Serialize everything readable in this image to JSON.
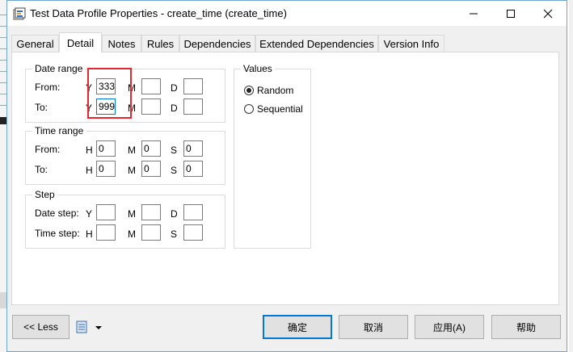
{
  "window": {
    "title": "Test Data Profile Properties - create_time (create_time)"
  },
  "tabs": [
    {
      "label": "General",
      "active": false
    },
    {
      "label": "Detail",
      "active": true
    },
    {
      "label": "Notes",
      "active": false
    },
    {
      "label": "Rules",
      "active": false
    },
    {
      "label": "Dependencies",
      "active": false
    },
    {
      "label": "Extended Dependencies",
      "active": false
    },
    {
      "label": "Version Info",
      "active": false
    }
  ],
  "date_range": {
    "title": "Date range",
    "from_label": "From:",
    "to_label": "To:",
    "y": "Y",
    "m": "M",
    "d": "D",
    "from_y": "333",
    "from_m": "",
    "from_d": "",
    "to_y": "999",
    "to_m": "",
    "to_d": ""
  },
  "time_range": {
    "title": "Time range",
    "from_label": "From:",
    "to_label": "To:",
    "h": "H",
    "m": "M",
    "s": "S",
    "from_h": "0",
    "from_m": "0",
    "from_s": "0",
    "to_h": "0",
    "to_m": "0",
    "to_s": "0"
  },
  "step": {
    "title": "Step",
    "date_label": "Date step:",
    "time_label": "Time step:",
    "y": "Y",
    "m": "M",
    "d": "D",
    "h": "H",
    "s": "S",
    "date_y": "",
    "date_m": "",
    "date_d": "",
    "time_h": "",
    "time_m": "",
    "time_s": ""
  },
  "values": {
    "title": "Values",
    "random_label": "Random",
    "sequential_label": "Sequential",
    "selected": "Random"
  },
  "buttons": {
    "less": "<< Less",
    "ok": "确定",
    "cancel": "取消",
    "apply": "应用(A)",
    "help": "帮助"
  },
  "colors": {
    "accent": "#0078d7",
    "highlight": "#e0282e",
    "window_border": "#6fa5cf"
  }
}
